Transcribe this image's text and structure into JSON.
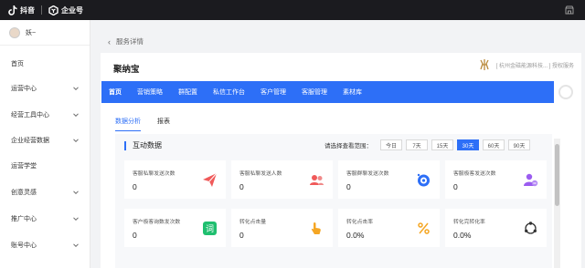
{
  "topbar": {
    "app_name": "抖音",
    "product_name": "企业号"
  },
  "user": {
    "name": "妖~"
  },
  "sidebar": {
    "items": [
      {
        "label": "首页",
        "expandable": false
      },
      {
        "label": "运营中心",
        "expandable": true
      },
      {
        "label": "经营工具中心",
        "expandable": true
      },
      {
        "label": "企业经营数据",
        "expandable": true
      },
      {
        "label": "运营学堂",
        "expandable": false
      },
      {
        "label": "创意灵感",
        "expandable": true
      },
      {
        "label": "推广中心",
        "expandable": true
      },
      {
        "label": "账号中心",
        "expandable": true
      }
    ]
  },
  "breadcrumb": {
    "back": "‹",
    "label": "服务详情"
  },
  "shop": {
    "name": "聚纳宝",
    "right_text": "[ 杭州金磁能源科技... ] 授权服务"
  },
  "tabs": [
    "首页",
    "营销策略",
    "群配置",
    "私信工作台",
    "客户管理",
    "客服管理",
    "素材库"
  ],
  "subtabs": [
    "数据分析",
    "报表"
  ],
  "panel": {
    "title": "互动数据",
    "range_label": "请选择查看范围：",
    "ranges": [
      "今日",
      "7天",
      "15天",
      "30天",
      "60天",
      "90天"
    ],
    "active_range": "30天"
  },
  "metrics": [
    {
      "label": "客服私聊发送次数",
      "value": "0",
      "icon": "paper-plane-icon"
    },
    {
      "label": "客服私聊发送人数",
      "value": "0",
      "icon": "users-icon"
    },
    {
      "label": "客服群聊发送次数",
      "value": "0",
      "icon": "chat-bubble-icon"
    },
    {
      "label": "客服极客发送次数",
      "value": "0",
      "icon": "user-minus-icon"
    },
    {
      "label": "客户极客询数发次数",
      "value": "0",
      "icon": "word-icon"
    },
    {
      "label": "转化点击量",
      "value": "0",
      "icon": "tap-icon"
    },
    {
      "label": "转化点击率",
      "value": "0.0%",
      "icon": "percent-icon"
    },
    {
      "label": "转化完转化率",
      "value": "0.0%",
      "icon": "cycle-icon"
    }
  ],
  "colors": {
    "accent": "#2d6ff7",
    "topbar": "#1b1b1f"
  }
}
